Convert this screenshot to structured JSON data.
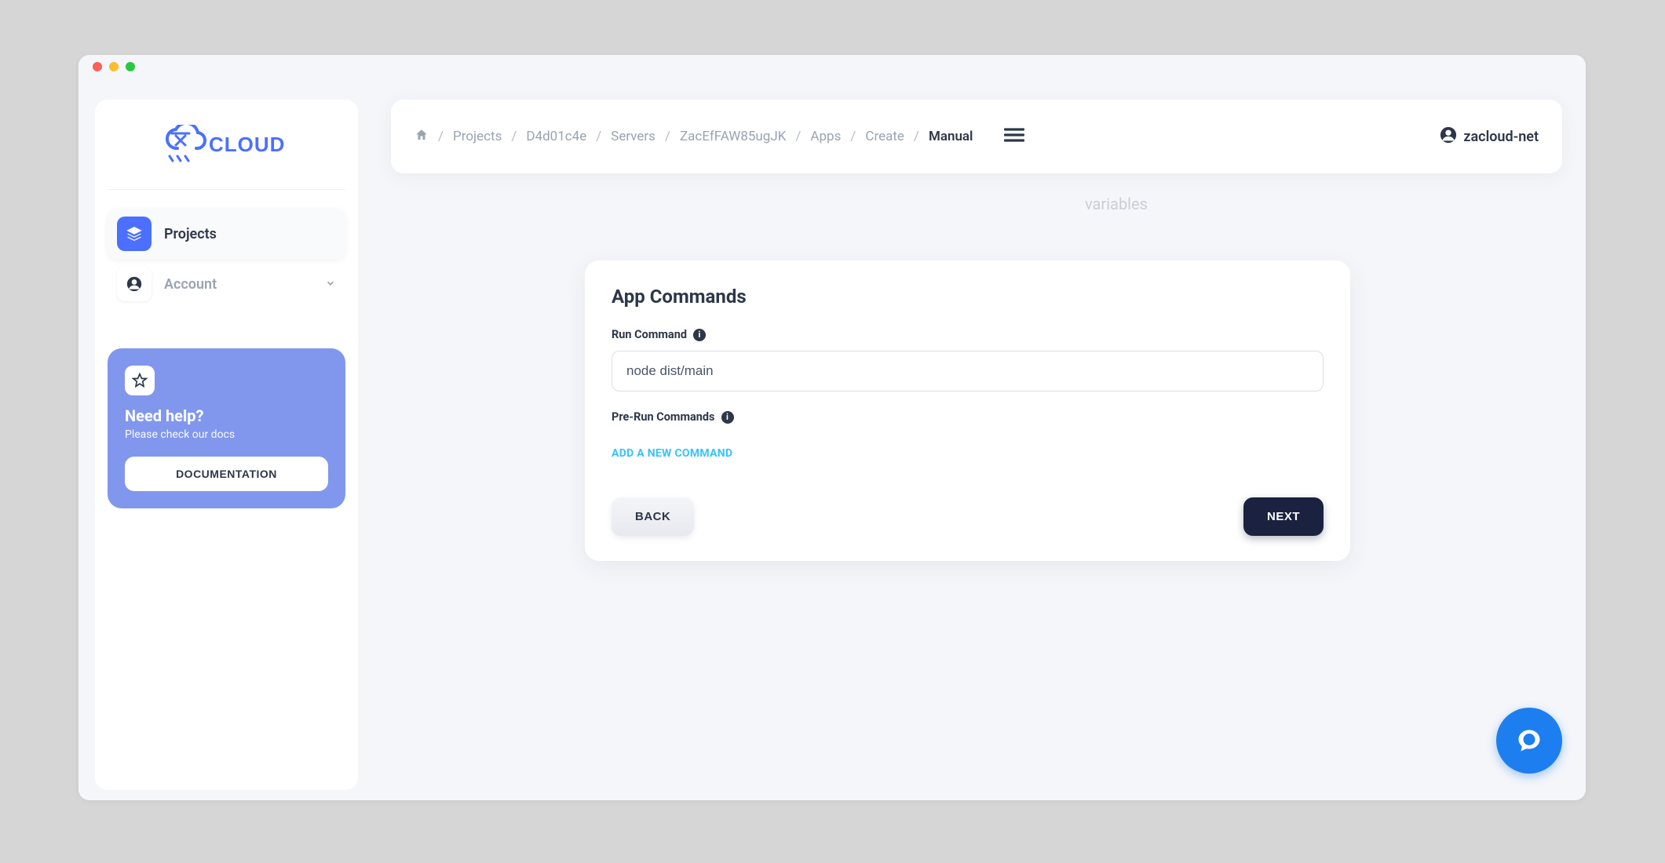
{
  "logo_text": "CLOUD",
  "sidebar": {
    "nav": [
      {
        "label": "Projects",
        "active": true
      },
      {
        "label": "Account",
        "active": false
      }
    ],
    "help": {
      "title": "Need help?",
      "subtitle": "Please check our docs",
      "button": "DOCUMENTATION"
    }
  },
  "breadcrumbs": [
    "Projects",
    "D4d01c4e",
    "Servers",
    "ZacEfFAW85ugJK",
    "Apps",
    "Create",
    "Manual"
  ],
  "user": {
    "name": "zacloud-net"
  },
  "bg_hint": "variables",
  "card": {
    "title": "App Commands",
    "run_command_label": "Run Command",
    "run_command_value": "node dist/main",
    "prerun_label": "Pre-Run Commands",
    "add_command": "ADD A NEW COMMAND",
    "back": "BACK",
    "next": "NEXT"
  }
}
